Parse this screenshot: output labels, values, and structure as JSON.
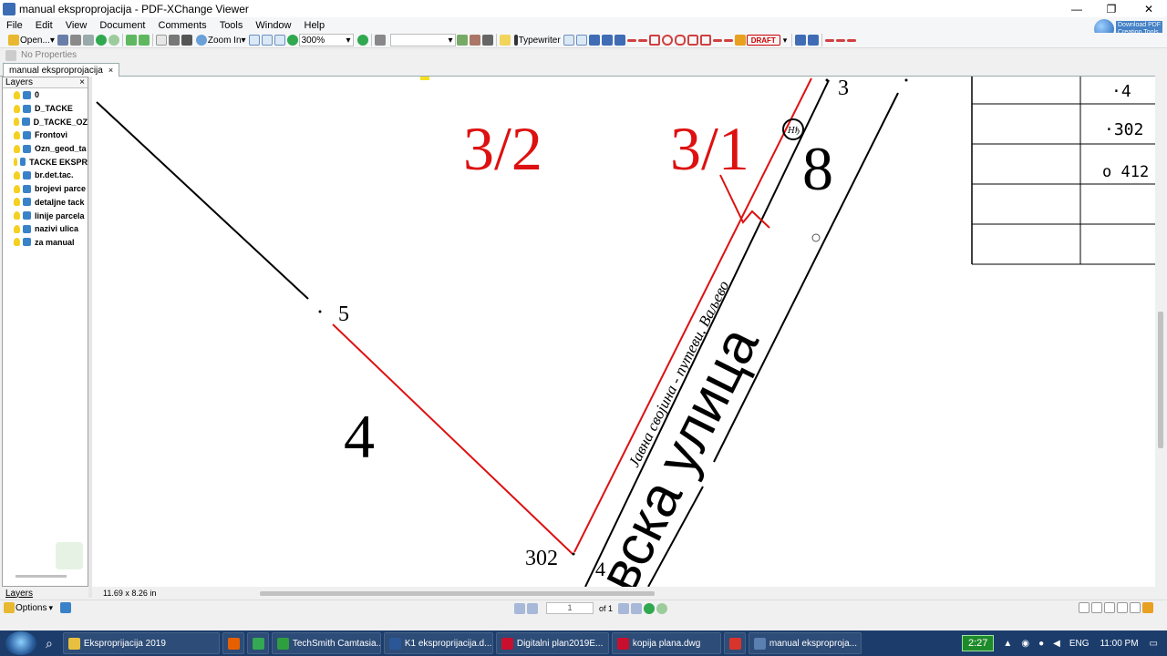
{
  "window": {
    "title": "manual eksproprojacija - PDF-XChange Viewer",
    "minimize": "—",
    "maximize": "❐",
    "close": "✕"
  },
  "menu": [
    "File",
    "Edit",
    "View",
    "Document",
    "Comments",
    "Tools",
    "Window",
    "Help"
  ],
  "toolbar": {
    "open_label": "Open...",
    "zoom_in_label": "Zoom In",
    "zoom_value": "300%",
    "typewriter_label": "Typewriter",
    "draft_stamp": "DRAFT"
  },
  "promo": {
    "line1": "Download PDF",
    "line2": "Creation Tools"
  },
  "properties": {
    "label": "No Properties"
  },
  "document_tab": {
    "name": "manual eksproprojacija",
    "close": "×"
  },
  "layers_panel": {
    "title": "Layers",
    "close": "×",
    "items": [
      "0",
      "D_TACKE",
      "D_TACKE_OZ",
      "Frontovi",
      "Ozn_geod_ta",
      "TACKE EKSPR",
      "br.det.tac.",
      "brojevi parce",
      "detaljne tack",
      "linije parcela",
      "nazivi ulica",
      "za manual"
    ],
    "tab_label": "Layers",
    "options_label": "Options"
  },
  "drawing": {
    "parcel_labels": [
      "3/2",
      "3/1"
    ],
    "big_numbers": [
      "4",
      "8"
    ],
    "point_numbers": [
      "5",
      "302",
      "4",
      "3"
    ],
    "street_name_small": "Јавна својина - путеви, Ваљево",
    "street_name_large": "вска улица",
    "circle_symbol": "Нђ",
    "table_values": [
      "·4",
      "·302",
      "ο 412"
    ],
    "colors": {
      "red": "#dd1111",
      "black": "#000000"
    }
  },
  "status": {
    "page_size": "11.69 x 8.26 in"
  },
  "navigation": {
    "page": "1",
    "of_label": "of 1"
  },
  "taskbar": {
    "items": [
      {
        "label": "Eksproprijacija 2019",
        "color": "#e8c040"
      },
      {
        "label": "",
        "color": "#e66000"
      },
      {
        "label": "",
        "color": "#34a853"
      },
      {
        "label": "TechSmith Camtasia...",
        "color": "#2e9e3e"
      },
      {
        "label": "K1 eksproprijacija.d...",
        "color": "#2b5797"
      },
      {
        "label": "Digitalni plan2019E...",
        "color": "#c8102e"
      },
      {
        "label": "kopija plana.dwg",
        "color": "#c8102e"
      },
      {
        "label": "",
        "color": "#d9342b"
      },
      {
        "label": "manual eksproproja...",
        "color": "#5a7fb0"
      }
    ],
    "timer": "2:27",
    "language": "ENG",
    "clock": "11:00 PM"
  }
}
